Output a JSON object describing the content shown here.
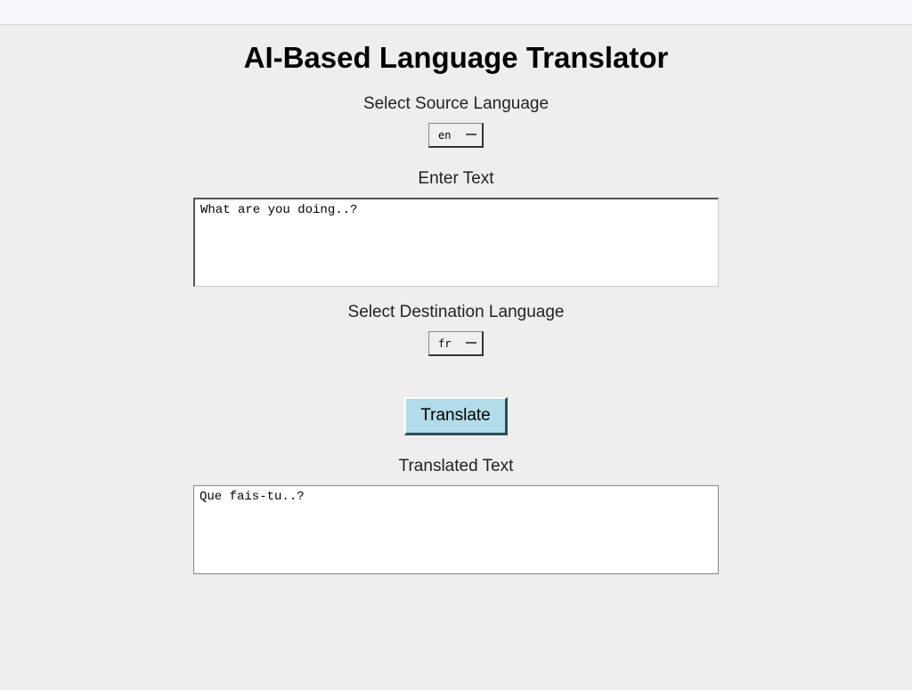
{
  "title": "AI-Based Language Translator",
  "sourceLang": {
    "label": "Select Source Language",
    "value": "en"
  },
  "input": {
    "label": "Enter Text",
    "value": "What are you doing..?"
  },
  "destLang": {
    "label": "Select Destination Language",
    "value": "fr"
  },
  "translateButton": "Translate",
  "output": {
    "label": "Translated Text",
    "value": "Que fais-tu..?"
  }
}
